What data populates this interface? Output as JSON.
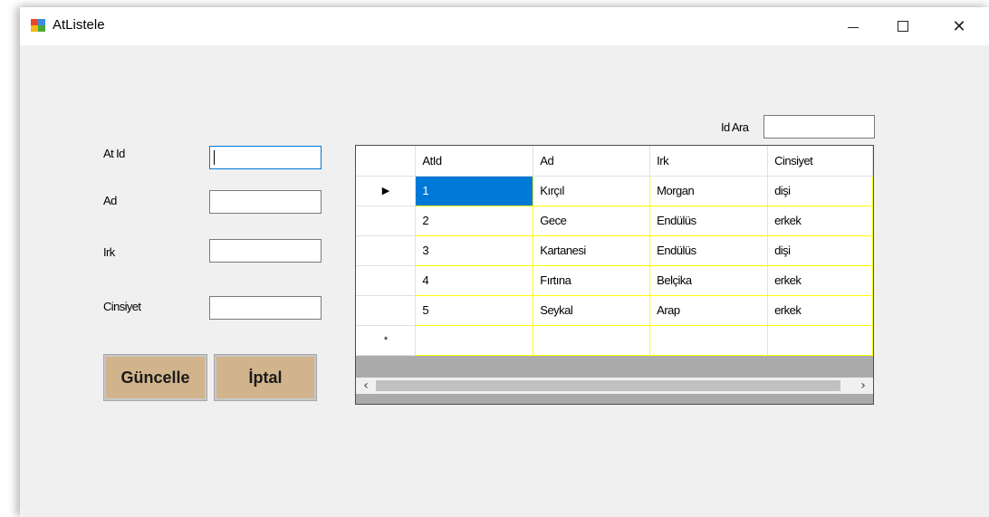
{
  "window": {
    "title": "AtListele"
  },
  "form": {
    "at_id_label": "At Id",
    "at_id_value": "",
    "ad_label": "Ad",
    "ad_value": "",
    "irk_label": "Irk",
    "irk_value": "",
    "cinsiyet_label": "Cinsiyet",
    "cinsiyet_value": "",
    "guncelle_label": "Güncelle",
    "iptal_label": "İptal",
    "id_ara_label": "Id Ara",
    "id_ara_value": ""
  },
  "grid": {
    "columns": [
      "AtId",
      "Ad",
      "Irk",
      "Cinsiyet"
    ],
    "rows": [
      [
        "1",
        "Kırçıl",
        "Morgan",
        "dişi"
      ],
      [
        "2",
        "Gece",
        "Endülüs",
        "erkek"
      ],
      [
        "3",
        "Kartanesi",
        "Endülüs",
        "dişi"
      ],
      [
        "4",
        "Fırtına",
        "Belçika",
        "erkek"
      ],
      [
        "5",
        "Seykal",
        "Arap",
        "erkek"
      ]
    ],
    "current_row_marker": "▶",
    "new_row_marker": "*"
  },
  "icons": {
    "app": "app-window-icon",
    "minimize": "minimize-icon",
    "maximize": "maximize-icon",
    "close": "close-icon",
    "scroll_left": "chevron-left-icon",
    "scroll_right": "chevron-right-icon"
  },
  "colors": {
    "button_bg": "#d2b48c",
    "grid_line": "#ffff00",
    "selection": "#0078d7",
    "focus_border": "#0078d7"
  }
}
